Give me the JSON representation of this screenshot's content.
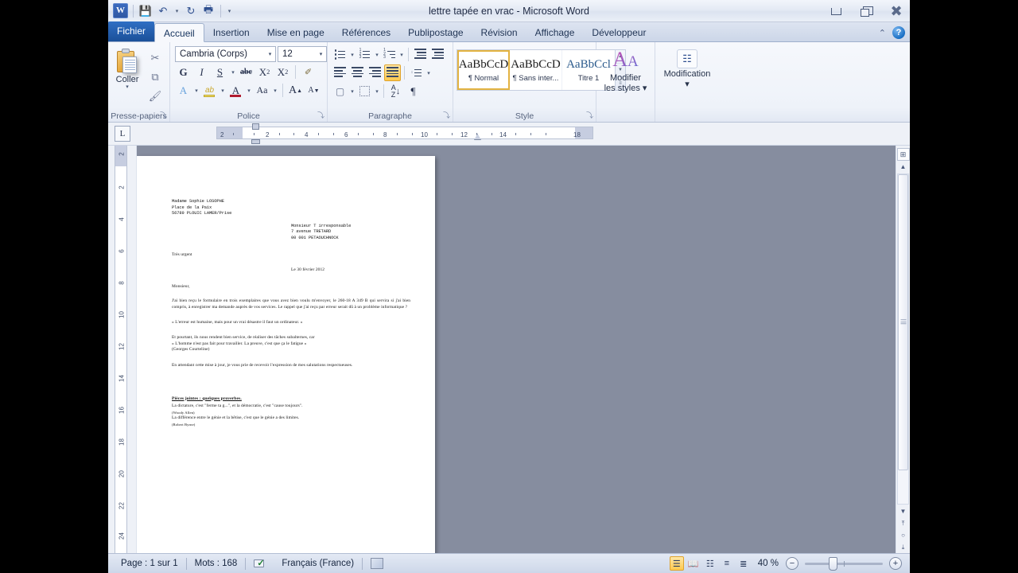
{
  "window": {
    "title": "lettre tapée en vrac  -  Microsoft Word",
    "app_logo": "W",
    "minimize": "minimize-icon",
    "restore": "restore-icon",
    "close": "close-icon"
  },
  "quick_access": [
    {
      "name": "save",
      "glyph": "💾"
    },
    {
      "name": "undo",
      "glyph": "↶"
    },
    {
      "name": "redo",
      "glyph": "↻"
    },
    {
      "name": "print-preview",
      "glyph": "🖨"
    },
    {
      "name": "customize",
      "glyph": "▾"
    }
  ],
  "tabs": [
    {
      "label": "Fichier",
      "id": "fichier",
      "active": false,
      "file": true
    },
    {
      "label": "Accueil",
      "id": "accueil",
      "active": true
    },
    {
      "label": "Insertion",
      "id": "insertion",
      "active": false
    },
    {
      "label": "Mise en page",
      "id": "mise-en-page",
      "active": false
    },
    {
      "label": "Références",
      "id": "references",
      "active": false
    },
    {
      "label": "Publipostage",
      "id": "publipostage",
      "active": false
    },
    {
      "label": "Révision",
      "id": "revision",
      "active": false
    },
    {
      "label": "Affichage",
      "id": "affichage",
      "active": false
    },
    {
      "label": "Développeur",
      "id": "developpeur",
      "active": false
    }
  ],
  "tab_right": {
    "minimize_ribbon": "⌃",
    "help": "?"
  },
  "ribbon": {
    "clipboard": {
      "label": "Presse-papiers",
      "paste": "Coller",
      "paste_caret": "▾",
      "cut": "✂",
      "copy": "⧉",
      "format_painter": "🖌",
      "dialog_launcher": "⤵"
    },
    "font": {
      "label": "Police",
      "font_name": "Cambria (Corps)",
      "font_size": "12",
      "dropdown_caret": "▾",
      "bold": "G",
      "italic": "I",
      "underline": "S",
      "strikethrough": "abc",
      "subscript": "X",
      "superscript": "X",
      "text_effects": "A",
      "highlight": "ab",
      "font_color": "A",
      "change_case": "Aa",
      "grow_font": "A",
      "shrink_font": "A",
      "clear_format": "✐",
      "dialog_launcher": "⤵"
    },
    "paragraph": {
      "label": "Paragraphe",
      "bullets": "bullet-list",
      "numbering": "numbered-list",
      "multilevel": "multilevel-list",
      "decrease_indent": "⬅",
      "increase_indent": "➡",
      "align_left": "align-left",
      "align_center": "align-center",
      "align_right": "align-right",
      "align_justify": "align-justify",
      "line_spacing": "line-spacing",
      "shading": "shading",
      "borders": "borders",
      "sort": "sort",
      "show_marks": "¶",
      "dialog_launcher": "⤵"
    },
    "styles": {
      "label": "Style",
      "items": [
        {
          "preview": "AaBbCcD",
          "name": "¶ Normal",
          "selected": true
        },
        {
          "preview": "AaBbCcD",
          "name": "¶ Sans inter...",
          "selected": false
        },
        {
          "preview": "AaBbCcl",
          "name": "Titre 1",
          "selected": false,
          "heading": true
        }
      ],
      "scroll_up": "▲",
      "scroll_down": "▼",
      "more": "≡",
      "change_styles": "Modifier\nles styles",
      "change_styles_l1": "Modifier",
      "change_styles_l2": "les styles ▾",
      "dialog_launcher": "⤵"
    },
    "editing": {
      "label": "Modification",
      "title_l1": "Modification",
      "title_l2": "▾",
      "icon": "binoculars-icon"
    }
  },
  "ruler": {
    "tab_stop_selector": "L",
    "horizontal_ticks": [
      "2",
      "2",
      "4",
      "6",
      "8",
      "10",
      "12",
      "14",
      "18"
    ],
    "vertical_ticks": [
      "2",
      "2",
      "4",
      "6",
      "8",
      "10",
      "12",
      "14",
      "16",
      "18",
      "20",
      "22",
      "24"
    ]
  },
  "document": {
    "sender": [
      "Madame Sophie LOSOPHE",
      "Place de la Paix",
      "56789 PLOUIC LAMER/Prise"
    ],
    "recipient": [
      "Monsieur T irresponsable",
      "7 avenue TRETARD",
      "00 001 PETAOUCHNOCK"
    ],
    "urgency": "Très urgent",
    "date": "Le 30 février 2012",
    "salutation": "Monsieur,",
    "paragraph1": "J'ai bien reçu le formulaire en trois exemplaires que vous avez bien voulu m'envoyer, le 260-18 A 349 B  qui servira si j'ai bien compris, à enregistrer ma demande auprès de vos services.  Le rappel que j'ai reçu par erreur serait dû à un problème informatique ?",
    "quote1": "« L'erreur est humaine, mais pour un vrai désastre il faut un ordinateur. »",
    "paragraph2": "Et pourtant, ils nous rendent bien service, de réaliser des tâches subalternes, car",
    "quote2": "« L'homme n'est pas fait pour travailler. La preuve, c'est que ça le fatigue »",
    "quote2_author": "(Georges Courteline)",
    "closing": "En attendant cette mise à jour, je vous prie de recevoir l'expression de mes salutations respectueuses.",
    "attachments_title": "Pièces jointes : quelques proverbes.",
    "proverb1": "La dictature, c'est \"ferme ta g...\", et la démocratie, c'est \"cause toujours\".",
    "proverb1_author": "(Woody Allen)",
    "proverb2": "La différence entre le génie et la bêtise, c'est que le génie a des limites.",
    "proverb2_author": "(Robert Byrne)"
  },
  "status_bar": {
    "page": "Page : 1 sur 1",
    "words": "Mots : 168",
    "language": "Français (France)",
    "proofing_icon": "spell-check-icon",
    "macro_icon": "macro-record-icon",
    "zoom_level": "40 %",
    "zoom_out": "−",
    "zoom_in": "+",
    "views": [
      {
        "name": "print-layout",
        "glyph": "☰",
        "active": true
      },
      {
        "name": "full-screen-reading",
        "glyph": "📖",
        "active": false
      },
      {
        "name": "web-layout",
        "glyph": "☷",
        "active": false
      },
      {
        "name": "outline",
        "glyph": "≡",
        "active": false
      },
      {
        "name": "draft",
        "glyph": "≣",
        "active": false
      }
    ]
  },
  "scrollbar": {
    "up": "▲",
    "down": "▼",
    "prev_page": "⤒",
    "select_object": "○",
    "next_page": "⤓",
    "view_ruler": "view-ruler-icon"
  }
}
